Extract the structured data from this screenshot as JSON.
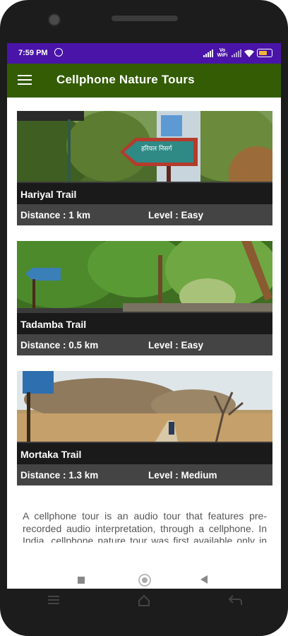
{
  "status_bar": {
    "time": "7:59 PM",
    "network_label": "Vo WiFi"
  },
  "app_bar": {
    "title": "Cellphone Nature Tours"
  },
  "trails": [
    {
      "name": "Hariyal Trail",
      "distance": "Distance : 1 km",
      "level": "Level : Easy",
      "sign_text": "हरियल निसर्ग"
    },
    {
      "name": "Tadamba Trail",
      "distance": "Distance : 0.5 km",
      "level": "Level : Easy"
    },
    {
      "name": "Mortaka Trail",
      "distance": "Distance : 1.3 km",
      "level": "Level : Medium"
    }
  ],
  "description": "A cellphone tour is an audio tour that features pre-recorded audio interpretation, through a cellphone. In India, cellphone nature tour was first available only in the Sanjay Gandhi National",
  "colors": {
    "status_bar": "#4a14a8",
    "app_bar": "#335c05",
    "info_bar": "#444444",
    "battery": "#f2b533"
  }
}
